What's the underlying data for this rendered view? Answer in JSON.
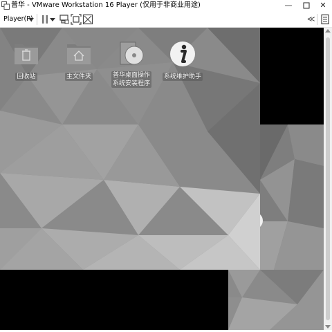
{
  "window": {
    "title": "普华 - VMware Workstation 16 Player (仅用于非商业用途)",
    "minimize_icon": "minimize-icon",
    "restore_icon": "restore-icon",
    "close_icon": "close-icon"
  },
  "toolbar": {
    "player_menu_label": "Player(P)",
    "icons": [
      "player-dropdown-icon",
      "pause-icon",
      "pause-dropdown-icon",
      "send-ctrl-alt-del-icon",
      "fit-guest-icon",
      "unity-icon",
      "collapse-toolbar-icon",
      "vm-library-icon"
    ],
    "collapse_label": "≪"
  },
  "desktop": {
    "icons": [
      {
        "label": "回收站",
        "icon": "trash-folder-icon"
      },
      {
        "label": "主文件夹",
        "icon": "home-folder-icon"
      },
      {
        "label": "普华桌面操作\n系统安装程序",
        "icon": "installer-cd-icon"
      },
      {
        "label": "系统维护助手",
        "icon": "info-icon"
      }
    ]
  },
  "colors": {
    "title_bg": "#ffffff",
    "vm_black": "#000000",
    "desktop_gray": "#8a8a8a"
  }
}
